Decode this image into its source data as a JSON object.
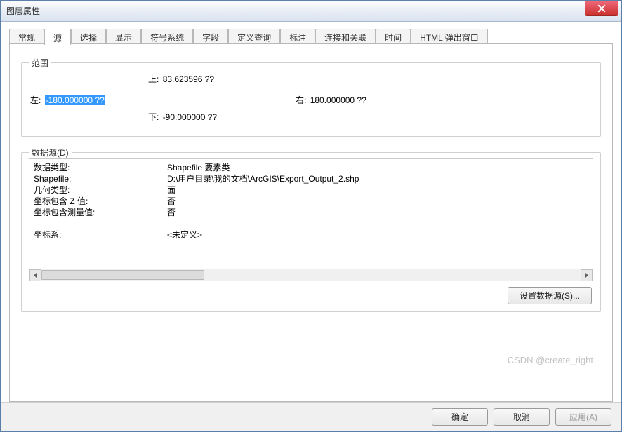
{
  "window": {
    "title": "图层属性"
  },
  "tabs": {
    "general": "常规",
    "source": "源",
    "selection": "选择",
    "display": "显示",
    "symbology": "符号系统",
    "fields": "字段",
    "definition_query": "定义查询",
    "labels": "标注",
    "joins_relates": "连接和关联",
    "time": "时间",
    "html_popup": "HTML 弹出窗口"
  },
  "extent": {
    "legend": "范围",
    "top_label": "上:",
    "top_value": "83.623596 ??",
    "left_label": "左:",
    "left_value": "-180.000000 ??",
    "right_label": "右:",
    "right_value": "180.000000 ??",
    "bottom_label": "下:",
    "bottom_value": "-90.000000 ??"
  },
  "datasource": {
    "legend": "数据源(D)",
    "rows": {
      "datatype_label": "数据类型:",
      "datatype_value": "Shapefile 要素类",
      "shapefile_label": "Shapefile:",
      "shapefile_value": "D:\\用户目录\\我的文档\\ArcGIS\\Export_Output_2.shp",
      "geomtype_label": "几何类型:",
      "geomtype_value": "面",
      "hasz_label": "坐标包含 Z 值:",
      "hasz_value": "否",
      "hasm_label": "坐标包含测量值:",
      "hasm_value": "否",
      "cs_label": "坐标系:",
      "cs_value": "<未定义>"
    },
    "set_button": "设置数据源(S)..."
  },
  "footer": {
    "ok": "确定",
    "cancel": "取消",
    "apply": "应用(A)"
  },
  "watermark": "CSDN @create_right"
}
